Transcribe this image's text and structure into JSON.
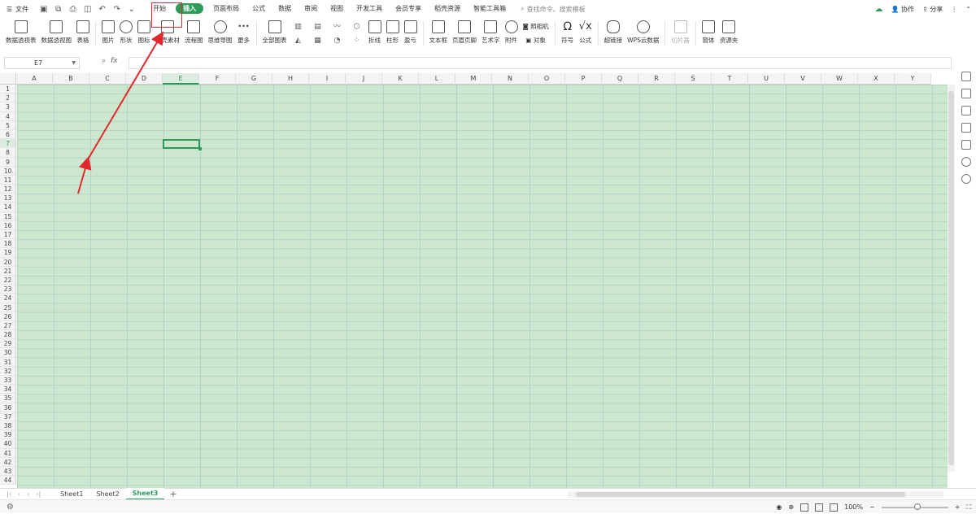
{
  "menubar": {
    "file_label": "文件",
    "tabs": [
      "开始",
      "插入",
      "页面布局",
      "公式",
      "数据",
      "审阅",
      "视图",
      "开发工具",
      "会员专享",
      "稻壳资源",
      "智能工具箱"
    ],
    "active_tab": "插入",
    "search_placeholder": "查找命令、搜索模板",
    "collab_label": "协作",
    "share_label": "分享"
  },
  "ribbon": {
    "items": [
      "数据透视表",
      "数据透视图",
      "表格",
      "图片",
      "形状",
      "图标",
      "稻壳素材",
      "流程图",
      "思维导图",
      "更多",
      "全部图表",
      "折线",
      "柱形",
      "盈亏",
      "文本框",
      "页眉页脚",
      "艺术字",
      "附件",
      "对象",
      "符号",
      "公式",
      "超链接",
      "WPS云数据",
      "切片器",
      "窗体",
      "资源夹"
    ],
    "camera_label": "照相机"
  },
  "formula_bar": {
    "name_box": "E7",
    "fx": "fx",
    "value": ""
  },
  "columns": [
    "A",
    "B",
    "C",
    "D",
    "E",
    "F",
    "G",
    "H",
    "I",
    "J",
    "K",
    "L",
    "M",
    "N",
    "O",
    "P",
    "Q",
    "R",
    "S",
    "T",
    "U",
    "V",
    "W",
    "X",
    "Y"
  ],
  "rows": [
    "1",
    "2",
    "3",
    "4",
    "5",
    "6",
    "7",
    "8",
    "9",
    "10",
    "11",
    "12",
    "13",
    "14",
    "15",
    "16",
    "17",
    "18",
    "19",
    "20",
    "21",
    "22",
    "23",
    "24",
    "25",
    "26",
    "27",
    "28",
    "29",
    "30",
    "31",
    "32",
    "33",
    "34",
    "35",
    "36",
    "37",
    "38",
    "39",
    "40",
    "41",
    "42",
    "43",
    "44"
  ],
  "selected_cell": "E7",
  "sheets": [
    "Sheet1",
    "Sheet2",
    "Sheet3"
  ],
  "active_sheet": "Sheet3",
  "status": {
    "zoom": "100%"
  },
  "colors": {
    "accent": "#2d9b5a",
    "grid_bg": "#cde7cf",
    "annotation": "#e0282d"
  }
}
